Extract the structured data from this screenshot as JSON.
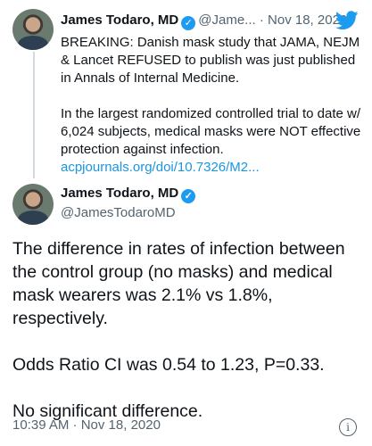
{
  "tweet1": {
    "name": "James Todaro, MD",
    "handle": "@Jame...",
    "separator": "·",
    "date": "Nov 18, 2020",
    "text_p1": "BREAKING: Danish mask study that JAMA, NEJM & Lancet REFUSED to publish was just published in Annals of Internal Medicine.",
    "text_p2": "In the largest randomized controlled trial to date w/ 6,024 subjects, medical masks were NOT effective protection against infection.",
    "link": "acpjournals.org/doi/10.7326/M2..."
  },
  "tweet2": {
    "name": "James Todaro, MD",
    "handle": "@JamesTodaroMD",
    "p1": "The difference in rates of infection between the control group (no masks) and medical mask wearers was 2.1% vs 1.8%, respectively.",
    "p2": "Odds Ratio CI was 0.54 to 1.23, P=0.33.",
    "p3": "No significant difference.",
    "timestamp": "10:39 AM · Nov 18, 2020"
  },
  "icons": {
    "verified": "verified-badge-icon",
    "bird": "twitter-bird-icon",
    "info": "info-icon"
  },
  "colors": {
    "link": "#1b95e0",
    "verified": "#1d9bf0",
    "muted": "#536471"
  }
}
